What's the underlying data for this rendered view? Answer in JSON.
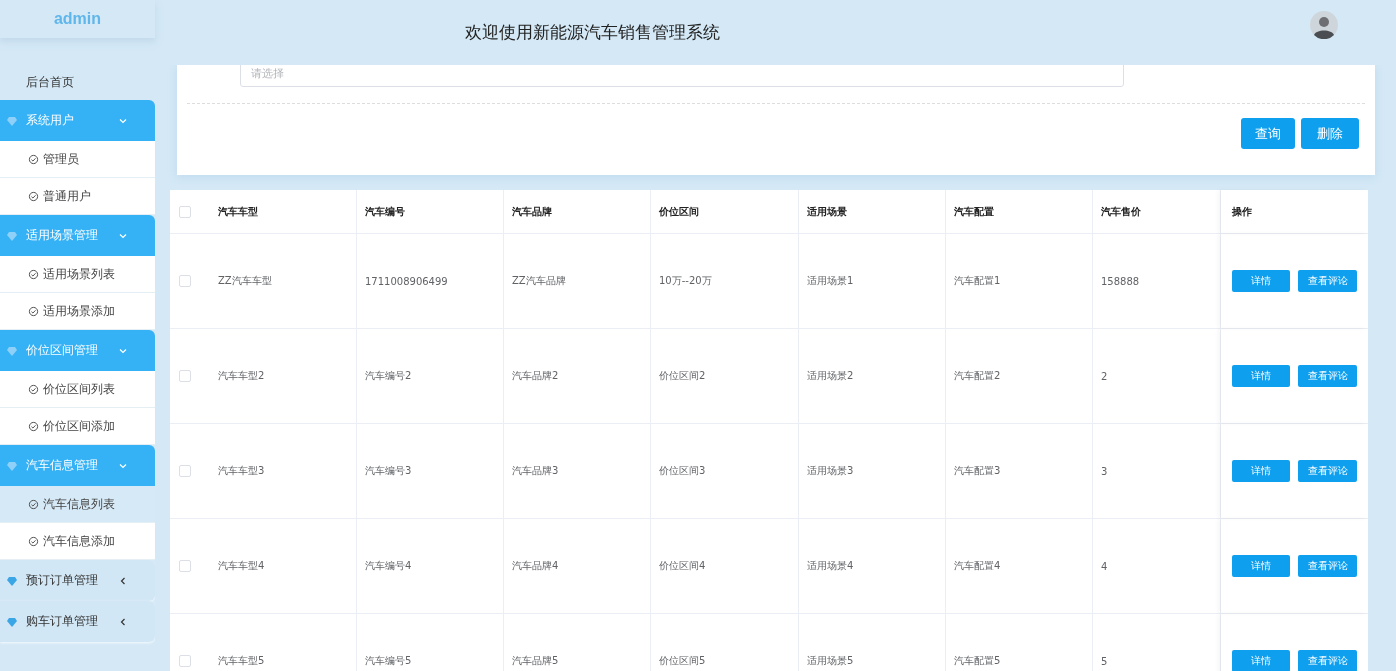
{
  "header": {
    "brand": "admin",
    "title": "欢迎使用新能源汽车销售管理系统"
  },
  "sidebar": {
    "items": [
      {
        "kind": "link",
        "label": "后台首页"
      },
      {
        "kind": "group",
        "label": "系统用户",
        "expanded": true,
        "children": [
          {
            "label": "管理员",
            "selected": false
          },
          {
            "label": "普通用户",
            "selected": false
          }
        ]
      },
      {
        "kind": "group",
        "label": "适用场景管理",
        "expanded": true,
        "children": [
          {
            "label": "适用场景列表",
            "selected": false
          },
          {
            "label": "适用场景添加",
            "selected": false
          }
        ]
      },
      {
        "kind": "group",
        "label": "价位区间管理",
        "expanded": true,
        "children": [
          {
            "label": "价位区间列表",
            "selected": false
          },
          {
            "label": "价位区间添加",
            "selected": false
          }
        ]
      },
      {
        "kind": "group",
        "label": "汽车信息管理",
        "expanded": true,
        "children": [
          {
            "label": "汽车信息列表",
            "selected": true
          },
          {
            "label": "汽车信息添加",
            "selected": false
          }
        ]
      },
      {
        "kind": "group",
        "label": "预订订单管理",
        "expanded": false
      },
      {
        "kind": "group",
        "label": "购车订单管理",
        "expanded": false
      }
    ]
  },
  "search": {
    "placeholder": "请选择",
    "buttons": [
      "查询",
      "删除"
    ]
  },
  "table": {
    "all_checked": false,
    "columns": [
      "汽车车型",
      "汽车编号",
      "汽车品牌",
      "价位区间",
      "适用场景",
      "汽车配置",
      "汽车售价",
      "操作"
    ],
    "rows": [
      {
        "checked": false,
        "cells": [
          "ZZ汽车车型",
          "1711008906499",
          "ZZ汽车品牌",
          "10万--20万",
          "适用场景1",
          "汽车配置1",
          "158888"
        ],
        "actions": [
          "详情",
          "查看评论"
        ]
      },
      {
        "checked": false,
        "cells": [
          "汽车车型2",
          "汽车编号2",
          "汽车品牌2",
          "价位区间2",
          "适用场景2",
          "汽车配置2",
          "2"
        ],
        "actions": [
          "详情",
          "查看评论"
        ]
      },
      {
        "checked": false,
        "cells": [
          "汽车车型3",
          "汽车编号3",
          "汽车品牌3",
          "价位区间3",
          "适用场景3",
          "汽车配置3",
          "3"
        ],
        "actions": [
          "详情",
          "查看评论"
        ]
      },
      {
        "checked": false,
        "cells": [
          "汽车车型4",
          "汽车编号4",
          "汽车品牌4",
          "价位区间4",
          "适用场景4",
          "汽车配置4",
          "4"
        ],
        "actions": [
          "详情",
          "查看评论"
        ]
      },
      {
        "checked": false,
        "cells": [
          "汽车车型5",
          "汽车编号5",
          "汽车品牌5",
          "价位区间5",
          "适用场景5",
          "汽车配置5",
          "5"
        ],
        "actions": [
          "详情",
          "查看评论"
        ]
      }
    ]
  }
}
